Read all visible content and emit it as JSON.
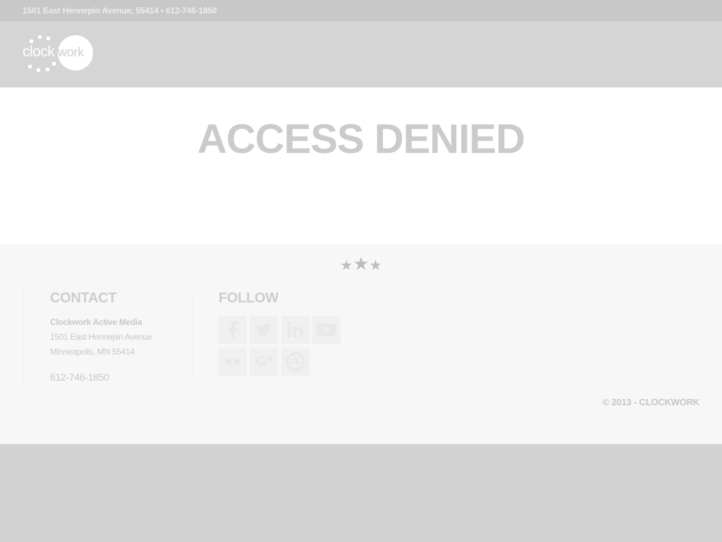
{
  "topbar": {
    "address_line": "1501 East Hennepin Avenue, 55414 • 612-746-1850"
  },
  "logo": {
    "part1": "clock",
    "part2": "work"
  },
  "main": {
    "title": "ACCESS DENIED"
  },
  "footer": {
    "stars": "★★★",
    "contact": {
      "heading": "CONTACT",
      "company": "Clockwork Active Media",
      "street": "1501 East Hennepin Avenue",
      "city": "Minneapolis, MN 55414",
      "phone": "612-746-1850"
    },
    "follow": {
      "heading": "FOLLOW",
      "icons": [
        "facebook-icon",
        "twitter-icon",
        "linkedin-icon",
        "youtube-icon",
        "flickr-icon",
        "google-plus-icon",
        "dribbble-icon"
      ]
    },
    "copyright": "© 2013 - CLOCKWORK"
  },
  "colors": {
    "topbar_bg": "#c8c8c8",
    "header_bg": "#d5d5d5",
    "main_bg": "#ffffff",
    "footer_bg": "#f7f7f7",
    "page_bg": "#d2d2d2",
    "title_text": "#cbcbcb"
  }
}
